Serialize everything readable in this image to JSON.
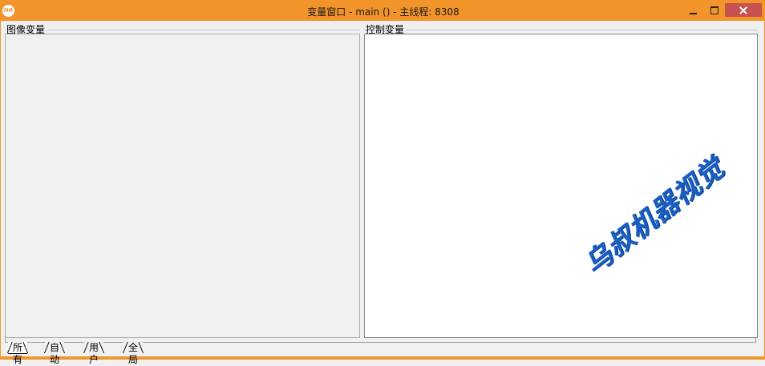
{
  "window": {
    "title": "变量窗口 - main () - 主线程: 8308",
    "icon_text": "HA",
    "accent_color": "#f3942b",
    "close_color": "#c75050"
  },
  "groups": {
    "image_vars_label": "图像变量",
    "control_vars_label": "控制变量"
  },
  "tabs": [
    {
      "label": "所有",
      "active": true
    },
    {
      "label": "自动",
      "active": false
    },
    {
      "label": "用户",
      "active": false
    },
    {
      "label": "全局",
      "active": false
    }
  ],
  "watermark": {
    "text": "乌叔机器视觉",
    "color": "#1a60c4"
  }
}
